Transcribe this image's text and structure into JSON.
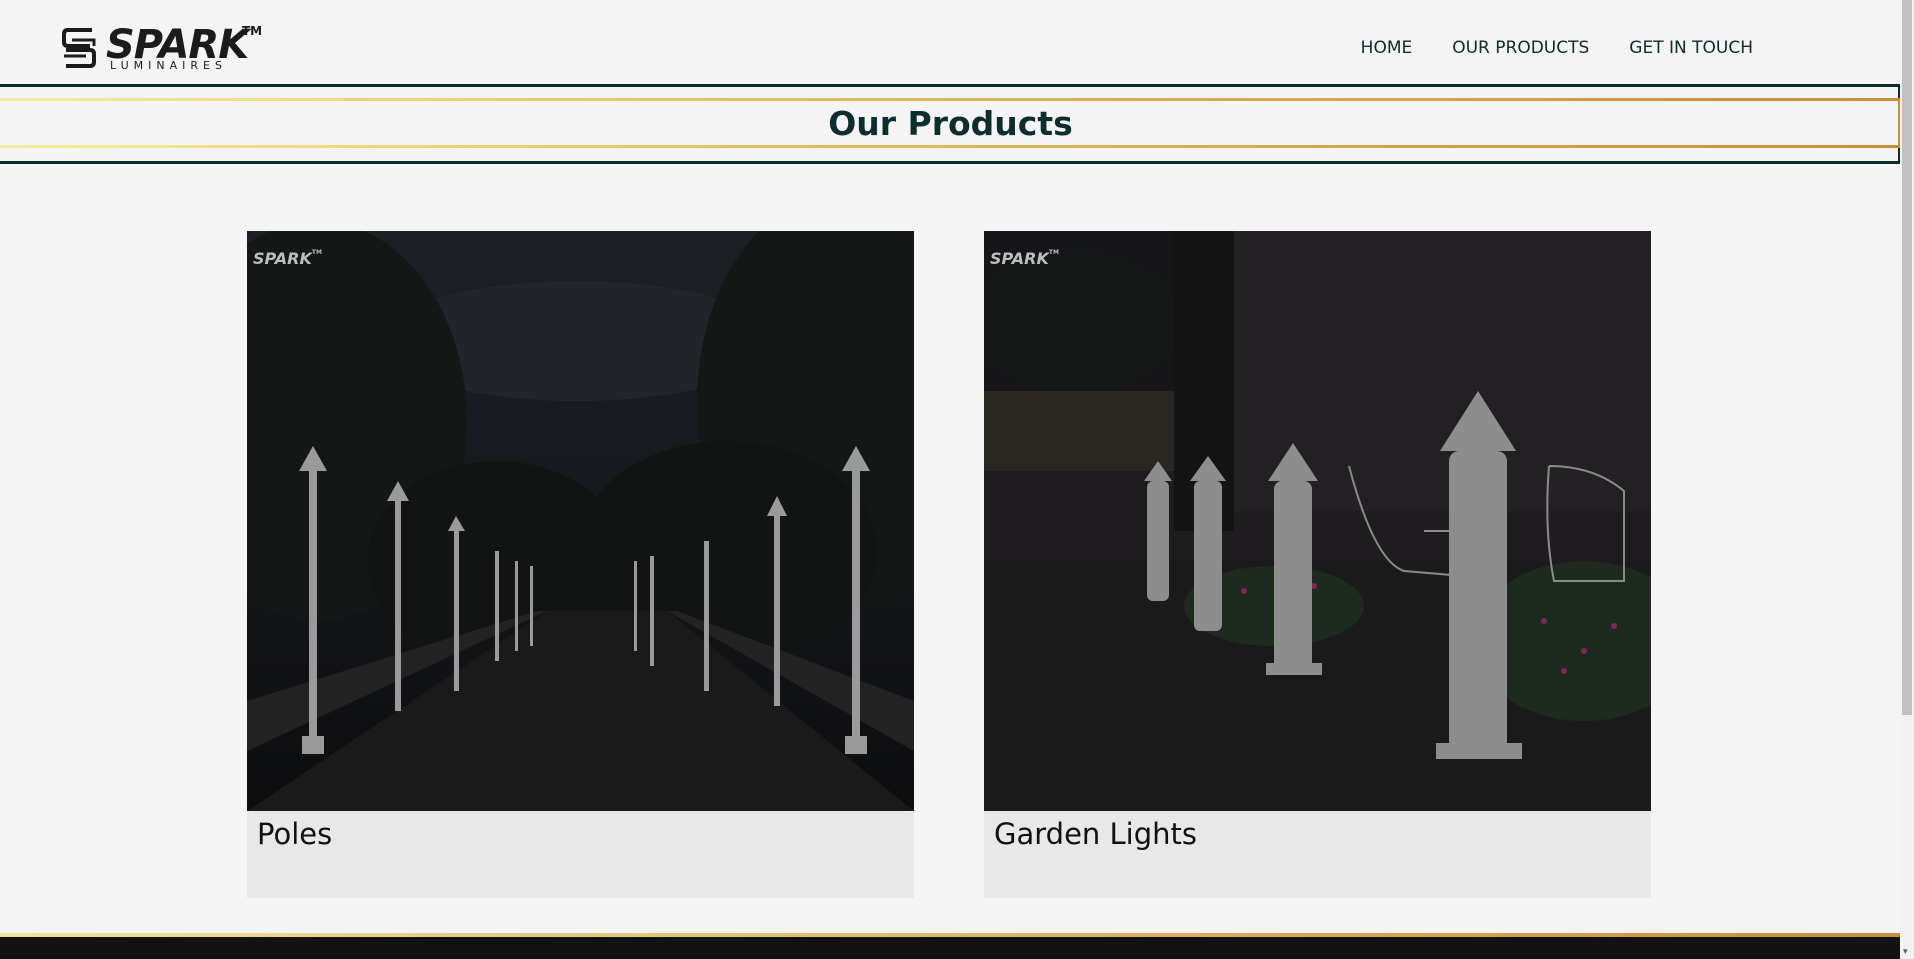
{
  "brand": {
    "name": "SPARK",
    "trademark": "TM",
    "subtitle": "LUMINAIRES"
  },
  "nav": {
    "items": [
      "HOME",
      "OUR PRODUCTS",
      "GET IN TOUCH"
    ]
  },
  "page": {
    "title": "Our Products"
  },
  "products": [
    {
      "label": "Poles",
      "watermark": "SPARK",
      "watermark_tm": "TM"
    },
    {
      "label": "Garden Lights",
      "watermark": "SPARK",
      "watermark_tm": "TM"
    }
  ],
  "colors": {
    "background": "#f4f4f4",
    "title": "#0e2e2e",
    "nav_text": "#0e2a2a",
    "banner_gold": "#c98d3c",
    "banner_pale": "#f3ee9c",
    "footer": "#121212"
  }
}
